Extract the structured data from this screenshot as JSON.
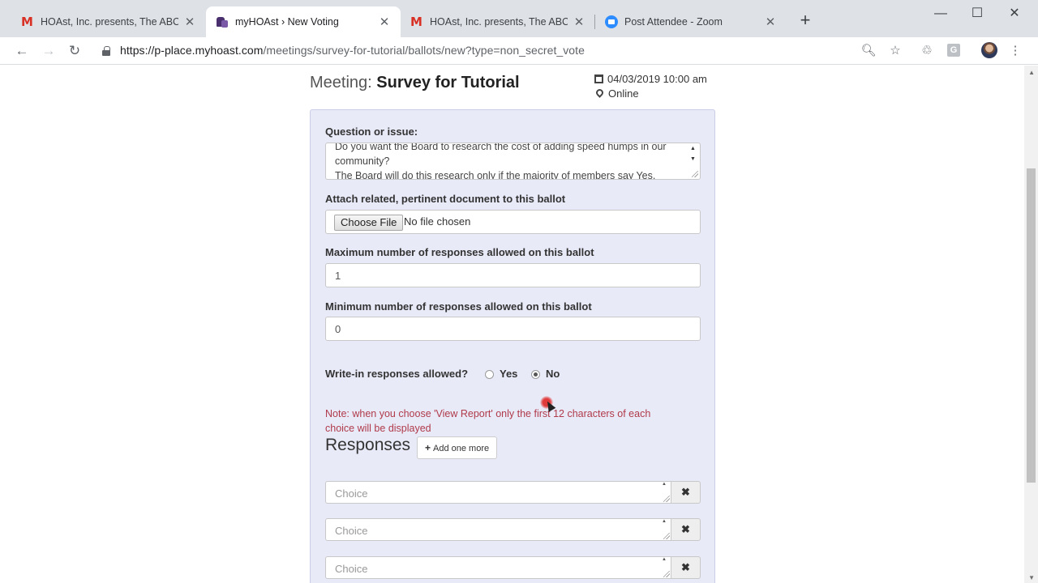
{
  "browser": {
    "tabs": [
      {
        "title": "HOAst, Inc. presents, The ABCs of",
        "icon": "gmail-icon",
        "active": false
      },
      {
        "title": "myHOAst › New Voting",
        "icon": "hoast-icon",
        "active": true
      },
      {
        "title": "HOAst, Inc. presents, The ABCs of",
        "icon": "gmail-icon",
        "active": false
      },
      {
        "title": "Post Attendee - Zoom",
        "icon": "zoom-icon",
        "active": false
      }
    ],
    "url_host": "https://p-place.myhoast.com",
    "url_path": "/meetings/survey-for-tutorial/ballots/new?type=non_secret_vote",
    "extension_g": "G"
  },
  "meeting": {
    "prefix": "Meeting:",
    "name": "Survey for Tutorial",
    "datetime": "04/03/2019 10:00 am",
    "location": "Online"
  },
  "form": {
    "question_label": "Question or issue:",
    "question_text": "Do you want the Board to research the cost of adding speed humps in our community?\nThe Board will do this research only if the majority of members say Yes.",
    "attach_label": "Attach related, pertinent document to this ballot",
    "choose_file_label": "Choose File",
    "no_file_text": "No file chosen",
    "max_label": "Maximum number of responses allowed on this ballot",
    "max_value": "1",
    "min_label": "Minimum number of responses allowed on this ballot",
    "min_value": "0",
    "writein_label": "Write-in responses allowed?",
    "writein_options": [
      {
        "label": "Yes",
        "selected": false
      },
      {
        "label": "No",
        "selected": true
      }
    ],
    "note": "Note: when you choose 'View Report' only the first 12 characters of each choice will be displayed",
    "responses_title": "Responses",
    "add_one_more_label": "Add one more",
    "choice_placeholders": [
      "Choice",
      "Choice",
      "Choice"
    ],
    "remove_glyph": "✖"
  },
  "colors": {
    "panel_bg": "#e8eaf8",
    "note_text": "#b03a4a"
  }
}
